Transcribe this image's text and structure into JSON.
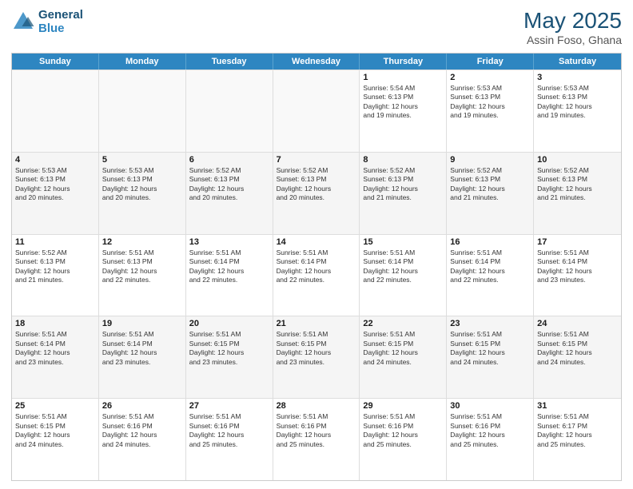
{
  "logo": {
    "line1": "General",
    "line2": "Blue"
  },
  "title": "May 2025",
  "location": "Assin Foso, Ghana",
  "days": [
    "Sunday",
    "Monday",
    "Tuesday",
    "Wednesday",
    "Thursday",
    "Friday",
    "Saturday"
  ],
  "weeks": [
    [
      {
        "day": "",
        "text": "",
        "empty": true
      },
      {
        "day": "",
        "text": "",
        "empty": true
      },
      {
        "day": "",
        "text": "",
        "empty": true
      },
      {
        "day": "",
        "text": "",
        "empty": true
      },
      {
        "day": "1",
        "text": "Sunrise: 5:54 AM\nSunset: 6:13 PM\nDaylight: 12 hours\nand 19 minutes.",
        "empty": false
      },
      {
        "day": "2",
        "text": "Sunrise: 5:53 AM\nSunset: 6:13 PM\nDaylight: 12 hours\nand 19 minutes.",
        "empty": false
      },
      {
        "day": "3",
        "text": "Sunrise: 5:53 AM\nSunset: 6:13 PM\nDaylight: 12 hours\nand 19 minutes.",
        "empty": false
      }
    ],
    [
      {
        "day": "4",
        "text": "Sunrise: 5:53 AM\nSunset: 6:13 PM\nDaylight: 12 hours\nand 20 minutes.",
        "empty": false
      },
      {
        "day": "5",
        "text": "Sunrise: 5:53 AM\nSunset: 6:13 PM\nDaylight: 12 hours\nand 20 minutes.",
        "empty": false
      },
      {
        "day": "6",
        "text": "Sunrise: 5:52 AM\nSunset: 6:13 PM\nDaylight: 12 hours\nand 20 minutes.",
        "empty": false
      },
      {
        "day": "7",
        "text": "Sunrise: 5:52 AM\nSunset: 6:13 PM\nDaylight: 12 hours\nand 20 minutes.",
        "empty": false
      },
      {
        "day": "8",
        "text": "Sunrise: 5:52 AM\nSunset: 6:13 PM\nDaylight: 12 hours\nand 21 minutes.",
        "empty": false
      },
      {
        "day": "9",
        "text": "Sunrise: 5:52 AM\nSunset: 6:13 PM\nDaylight: 12 hours\nand 21 minutes.",
        "empty": false
      },
      {
        "day": "10",
        "text": "Sunrise: 5:52 AM\nSunset: 6:13 PM\nDaylight: 12 hours\nand 21 minutes.",
        "empty": false
      }
    ],
    [
      {
        "day": "11",
        "text": "Sunrise: 5:52 AM\nSunset: 6:13 PM\nDaylight: 12 hours\nand 21 minutes.",
        "empty": false
      },
      {
        "day": "12",
        "text": "Sunrise: 5:51 AM\nSunset: 6:13 PM\nDaylight: 12 hours\nand 22 minutes.",
        "empty": false
      },
      {
        "day": "13",
        "text": "Sunrise: 5:51 AM\nSunset: 6:14 PM\nDaylight: 12 hours\nand 22 minutes.",
        "empty": false
      },
      {
        "day": "14",
        "text": "Sunrise: 5:51 AM\nSunset: 6:14 PM\nDaylight: 12 hours\nand 22 minutes.",
        "empty": false
      },
      {
        "day": "15",
        "text": "Sunrise: 5:51 AM\nSunset: 6:14 PM\nDaylight: 12 hours\nand 22 minutes.",
        "empty": false
      },
      {
        "day": "16",
        "text": "Sunrise: 5:51 AM\nSunset: 6:14 PM\nDaylight: 12 hours\nand 22 minutes.",
        "empty": false
      },
      {
        "day": "17",
        "text": "Sunrise: 5:51 AM\nSunset: 6:14 PM\nDaylight: 12 hours\nand 23 minutes.",
        "empty": false
      }
    ],
    [
      {
        "day": "18",
        "text": "Sunrise: 5:51 AM\nSunset: 6:14 PM\nDaylight: 12 hours\nand 23 minutes.",
        "empty": false
      },
      {
        "day": "19",
        "text": "Sunrise: 5:51 AM\nSunset: 6:14 PM\nDaylight: 12 hours\nand 23 minutes.",
        "empty": false
      },
      {
        "day": "20",
        "text": "Sunrise: 5:51 AM\nSunset: 6:15 PM\nDaylight: 12 hours\nand 23 minutes.",
        "empty": false
      },
      {
        "day": "21",
        "text": "Sunrise: 5:51 AM\nSunset: 6:15 PM\nDaylight: 12 hours\nand 23 minutes.",
        "empty": false
      },
      {
        "day": "22",
        "text": "Sunrise: 5:51 AM\nSunset: 6:15 PM\nDaylight: 12 hours\nand 24 minutes.",
        "empty": false
      },
      {
        "day": "23",
        "text": "Sunrise: 5:51 AM\nSunset: 6:15 PM\nDaylight: 12 hours\nand 24 minutes.",
        "empty": false
      },
      {
        "day": "24",
        "text": "Sunrise: 5:51 AM\nSunset: 6:15 PM\nDaylight: 12 hours\nand 24 minutes.",
        "empty": false
      }
    ],
    [
      {
        "day": "25",
        "text": "Sunrise: 5:51 AM\nSunset: 6:15 PM\nDaylight: 12 hours\nand 24 minutes.",
        "empty": false
      },
      {
        "day": "26",
        "text": "Sunrise: 5:51 AM\nSunset: 6:16 PM\nDaylight: 12 hours\nand 24 minutes.",
        "empty": false
      },
      {
        "day": "27",
        "text": "Sunrise: 5:51 AM\nSunset: 6:16 PM\nDaylight: 12 hours\nand 25 minutes.",
        "empty": false
      },
      {
        "day": "28",
        "text": "Sunrise: 5:51 AM\nSunset: 6:16 PM\nDaylight: 12 hours\nand 25 minutes.",
        "empty": false
      },
      {
        "day": "29",
        "text": "Sunrise: 5:51 AM\nSunset: 6:16 PM\nDaylight: 12 hours\nand 25 minutes.",
        "empty": false
      },
      {
        "day": "30",
        "text": "Sunrise: 5:51 AM\nSunset: 6:16 PM\nDaylight: 12 hours\nand 25 minutes.",
        "empty": false
      },
      {
        "day": "31",
        "text": "Sunrise: 5:51 AM\nSunset: 6:17 PM\nDaylight: 12 hours\nand 25 minutes.",
        "empty": false
      }
    ]
  ]
}
